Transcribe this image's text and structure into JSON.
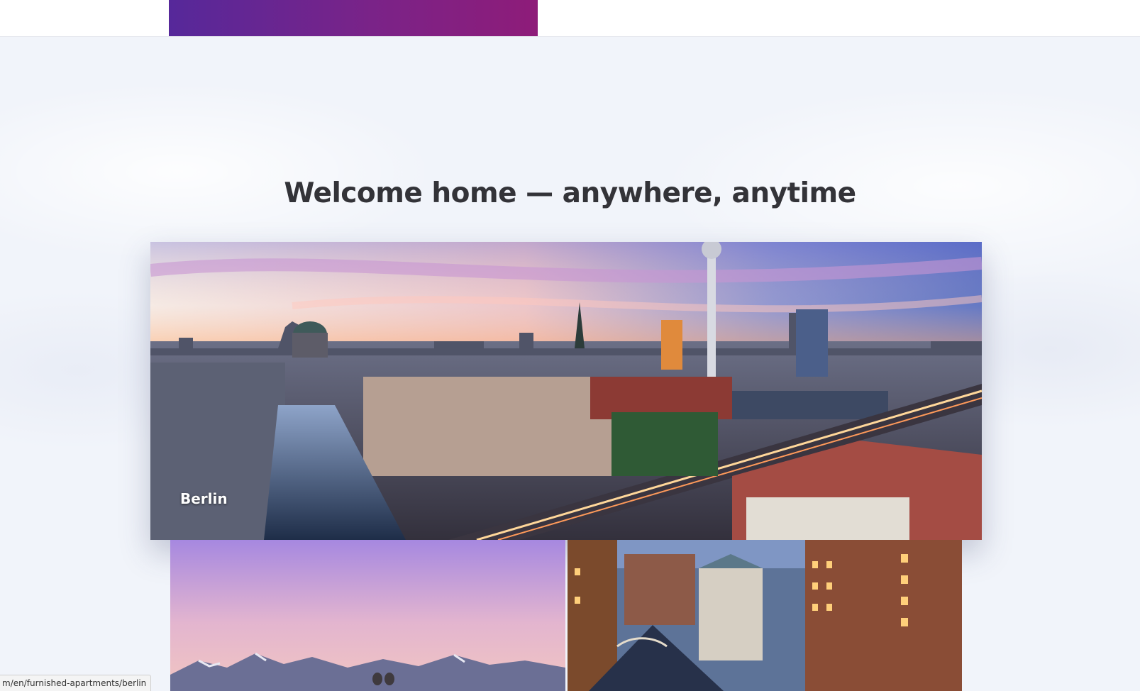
{
  "header": {
    "banner_gradient": [
      "#56289a",
      "#8e1c79"
    ]
  },
  "hero": {
    "headline": "Welcome home — anywhere, anytime"
  },
  "cities": [
    {
      "label": "Berlin",
      "image": "berlin-skyline-photo"
    },
    {
      "label": "",
      "image": "alps-mountain-photo"
    },
    {
      "label": "",
      "image": "hamburg-speicherstadt-photo"
    }
  ],
  "status_bar": {
    "url": "m/en/furnished-apartments/berlin"
  },
  "colors": {
    "headline": "#333338",
    "background": "#f1f4fa"
  }
}
